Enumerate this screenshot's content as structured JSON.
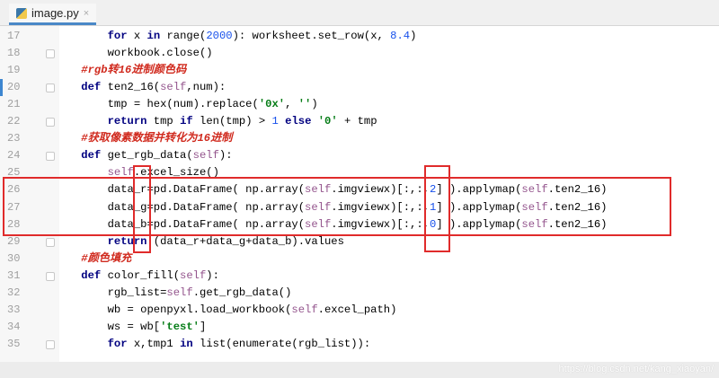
{
  "tab": {
    "filename": "image.py",
    "close": "×"
  },
  "lines": [
    {
      "n": "17",
      "indent": 2,
      "fold": false,
      "t": [
        [
          "for",
          "kw"
        ],
        " x ",
        [
          "in",
          "kw"
        ],
        " range(",
        [
          "2000",
          "num"
        ],
        "): worksheet.set_row(x, ",
        [
          "8.4",
          "num"
        ],
        ")"
      ]
    },
    {
      "n": "18",
      "indent": 2,
      "fold": true,
      "t": [
        "workbook.close()"
      ]
    },
    {
      "n": "19",
      "indent": 1,
      "fold": false,
      "t": [
        [
          "#rgb转16进制颜色码",
          "cm"
        ]
      ]
    },
    {
      "n": "20",
      "indent": 1,
      "fold": true,
      "marker": true,
      "t": [
        [
          "def",
          "kw"
        ],
        " ten2_16(",
        [
          "self",
          "self"
        ],
        ",num):"
      ]
    },
    {
      "n": "21",
      "indent": 2,
      "fold": false,
      "t": [
        "tmp = hex(num).replace(",
        [
          "'0x'",
          "str"
        ],
        ", ",
        [
          "''",
          "str"
        ],
        ")"
      ]
    },
    {
      "n": "22",
      "indent": 2,
      "fold": true,
      "t": [
        [
          "return",
          "kw"
        ],
        " tmp ",
        [
          "if",
          "kw"
        ],
        " len(tmp) > ",
        [
          "1",
          "num"
        ],
        " ",
        [
          "else",
          "kw"
        ],
        " ",
        [
          "'0'",
          "str"
        ],
        " + tmp"
      ]
    },
    {
      "n": "23",
      "indent": 1,
      "fold": false,
      "t": [
        [
          "#获取像素数据并转化为16进制",
          "cm"
        ]
      ]
    },
    {
      "n": "24",
      "indent": 1,
      "fold": true,
      "t": [
        [
          "def",
          "kw"
        ],
        " get_rgb_data(",
        [
          "self",
          "self"
        ],
        "):"
      ]
    },
    {
      "n": "25",
      "indent": 2,
      "fold": false,
      "t": [
        [
          "self",
          "self"
        ],
        ".excel_size()"
      ]
    },
    {
      "n": "26",
      "indent": 2,
      "fold": false,
      "t": [
        "data_r=pd.DataFrame( np.array(",
        [
          "self",
          "self"
        ],
        ".imgviewx)[:,:,",
        [
          "2",
          "num"
        ],
        "] ).applymap(",
        [
          "self",
          "self"
        ],
        ".ten2_16)"
      ]
    },
    {
      "n": "27",
      "indent": 2,
      "fold": false,
      "t": [
        "data_g=pd.DataFrame( np.array(",
        [
          "self",
          "self"
        ],
        ".imgviewx)[:,:,",
        [
          "1",
          "num"
        ],
        "] ).applymap(",
        [
          "self",
          "self"
        ],
        ".ten2_16)"
      ]
    },
    {
      "n": "28",
      "indent": 2,
      "fold": false,
      "t": [
        "data_b=pd.DataFrame( np.array(",
        [
          "self",
          "self"
        ],
        ".imgviewx)[:,:,",
        [
          "0",
          "num"
        ],
        "] ).applymap(",
        [
          "self",
          "self"
        ],
        ".ten2_16)"
      ]
    },
    {
      "n": "29",
      "indent": 2,
      "fold": true,
      "t": [
        [
          "return",
          "kw"
        ],
        " (data_r+data_g+data_b).values"
      ]
    },
    {
      "n": "30",
      "indent": 1,
      "fold": false,
      "t": [
        [
          "#颜色填充",
          "cm"
        ]
      ]
    },
    {
      "n": "31",
      "indent": 1,
      "fold": true,
      "t": [
        [
          "def",
          "kw"
        ],
        " color_fill(",
        [
          "self",
          "self"
        ],
        "):"
      ]
    },
    {
      "n": "32",
      "indent": 2,
      "fold": false,
      "t": [
        "rgb_list=",
        [
          "self",
          "self"
        ],
        ".get_rgb_data()"
      ]
    },
    {
      "n": "33",
      "indent": 2,
      "fold": false,
      "t": [
        "wb = openpyxl.load_workbook(",
        [
          "self",
          "self"
        ],
        ".excel_path)"
      ]
    },
    {
      "n": "34",
      "indent": 2,
      "fold": false,
      "t": [
        "ws = wb[",
        [
          "'test'",
          "str"
        ],
        "]"
      ]
    },
    {
      "n": "35",
      "indent": 2,
      "fold": true,
      "t": [
        [
          "for",
          "kw"
        ],
        " x,tmp1 ",
        [
          "in",
          "kw"
        ],
        " list(enumerate(rgb_list)):"
      ]
    }
  ],
  "watermark": "https://blog.csdn.net/kang_xiaoyan/"
}
